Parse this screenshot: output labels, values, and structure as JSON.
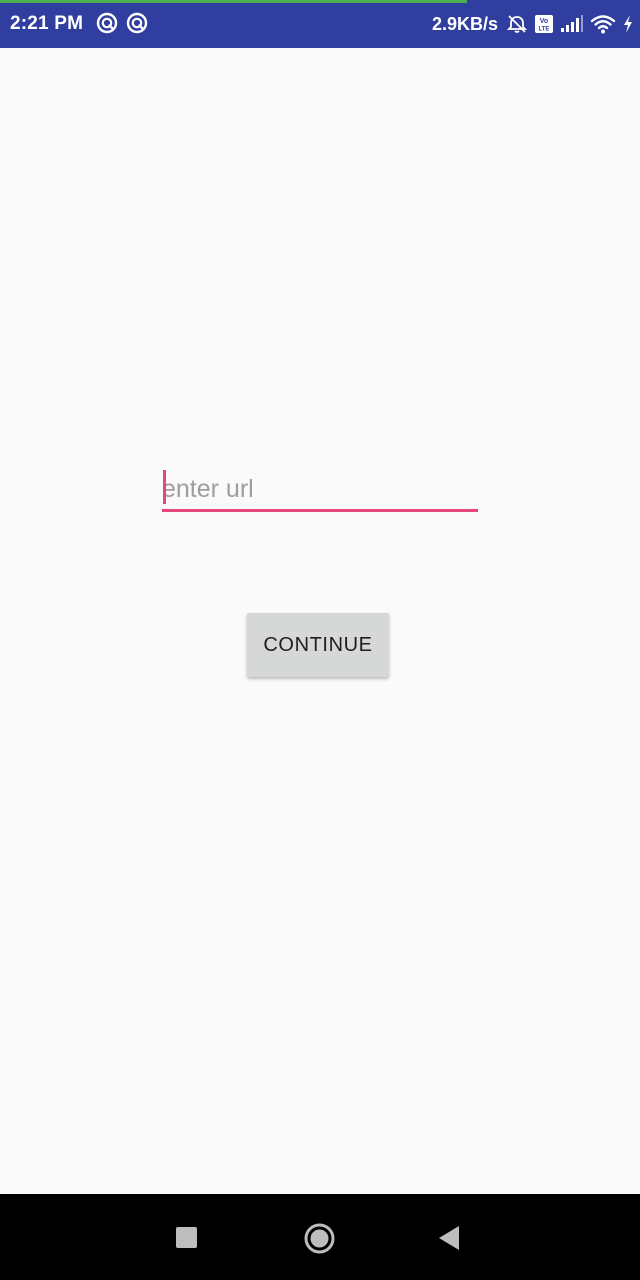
{
  "status_bar": {
    "time": "2:21 PM",
    "net_speed": "2.9KB/s",
    "left_icons": [
      "app-notification-icon",
      "app-notification-icon"
    ],
    "right_icons": [
      "alarm-off-icon",
      "volte-icon",
      "signal-icon",
      "wifi-icon",
      "charging-icon"
    ],
    "background_color": "#303f9f",
    "page_load_progress": 0.73,
    "progress_color": "#4caf50"
  },
  "form": {
    "url_input": {
      "value": "",
      "placeholder": "enter url"
    },
    "continue_label": "CONTINUE",
    "accent_color": "#e4487f"
  },
  "nav_bar": {
    "icons": [
      "recents-icon",
      "home-icon",
      "back-icon"
    ]
  }
}
